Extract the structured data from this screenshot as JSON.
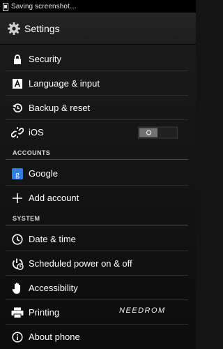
{
  "status_bar": {
    "text": "Saving screenshot…",
    "icon": "screenshot-icon"
  },
  "action_bar": {
    "title": "Settings",
    "icon": "gear-icon"
  },
  "items": [
    {
      "label": "Security",
      "icon": "lock-icon"
    },
    {
      "label": "Language & input",
      "icon": "keyboard-a-icon"
    },
    {
      "label": "Backup & reset",
      "icon": "restore-icon"
    },
    {
      "label": "iOS",
      "icon": "ios-link-icon",
      "toggle": false
    }
  ],
  "accounts": {
    "header": "ACCOUNTS",
    "items": [
      {
        "label": "Google",
        "icon": "google-icon"
      },
      {
        "label": "Add account",
        "icon": "plus-icon"
      }
    ]
  },
  "system": {
    "header": "SYSTEM",
    "items": [
      {
        "label": "Date & time",
        "icon": "clock-icon"
      },
      {
        "label": "Scheduled power on & off",
        "icon": "power-clock-icon"
      },
      {
        "label": "Accessibility",
        "icon": "hand-icon"
      },
      {
        "label": "Printing",
        "icon": "printer-icon"
      },
      {
        "label": "About phone",
        "icon": "info-icon"
      }
    ]
  },
  "watermark": "NEEDROM",
  "colors": {
    "background": "#141414",
    "status_bar": "#000000",
    "toggle_off": "#727272"
  }
}
